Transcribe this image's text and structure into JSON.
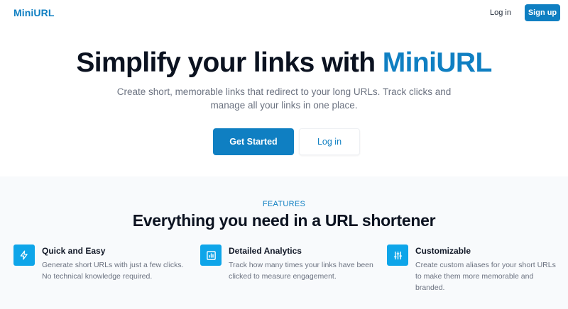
{
  "nav": {
    "logo": "MiniURL",
    "login": "Log in",
    "signup": "Sign up"
  },
  "hero": {
    "title_prefix": "Simplify your links with ",
    "title_accent": "MiniURL",
    "subtitle": "Create short, memorable links that redirect to your long URLs. Track clicks and manage all your links in one place.",
    "primary_cta": "Get Started",
    "secondary_cta": "Log in"
  },
  "features": {
    "eyebrow": "FEATURES",
    "title": "Everything you need in a URL shortener",
    "items": [
      {
        "icon": "lightning-icon",
        "title": "Quick and Easy",
        "description": "Generate short URLs with just a few clicks. No technical knowledge required."
      },
      {
        "icon": "bar-chart-icon",
        "title": "Detailed Analytics",
        "description": "Track how many times your links have been clicked to measure engagement."
      },
      {
        "icon": "sliders-icon",
        "title": "Customizable",
        "description": "Create custom aliases for your short URLs to make them more memorable and branded."
      }
    ]
  },
  "colors": {
    "brand": "#0f7fc2",
    "icon_bg": "#0ea5e9",
    "features_bg": "#f8fafc",
    "heading": "#0b1220",
    "muted": "#6b7280"
  }
}
